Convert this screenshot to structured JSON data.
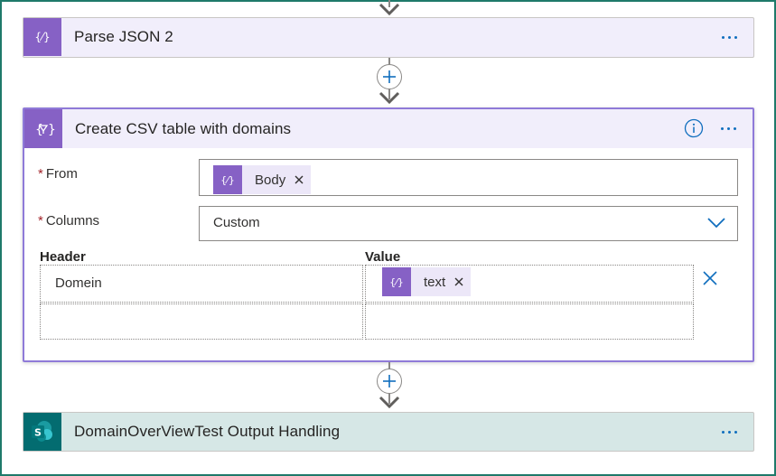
{
  "colors": {
    "accent": "#8661c5",
    "header_purple_bg": "#f1eefb",
    "sharepoint_bg": "#036c70",
    "sharepoint_header_bg": "#d6e7e6",
    "link_blue": "#106ebe",
    "required_red": "#a4262c",
    "frame_border": "#1f7a6a"
  },
  "steps": {
    "parse_json": {
      "title": "Parse JSON 2",
      "icon": "json-expression-icon",
      "menu_icon": "more-options-icon"
    },
    "create_csv": {
      "title": "Create CSV table with domains",
      "icon": "filter-expression-icon",
      "info_icon": "info-icon",
      "menu_icon": "more-options-icon",
      "fields": {
        "from": {
          "required_marker": "*",
          "label": "From",
          "token_label": "Body",
          "token_icon": "json-expression-icon"
        },
        "columns": {
          "required_marker": "*",
          "label": "Columns",
          "selected_value": "Custom",
          "dropdown_icon": "chevron-down-icon"
        }
      },
      "table": {
        "header_label": "Header",
        "value_label": "Value",
        "rows": [
          {
            "header": "Domein",
            "value_token": "text",
            "value_token_icon": "json-expression-icon",
            "delete_icon": "close-icon"
          },
          {
            "header": "",
            "value_token": ""
          }
        ]
      }
    },
    "sharepoint": {
      "title": "DomainOverViewTest Output Handling",
      "icon": "sharepoint-icon",
      "menu_icon": "more-options-icon"
    }
  },
  "connectors": {
    "add_step_icon": "plus-icon",
    "arrow_icon": "arrow-down-icon"
  }
}
